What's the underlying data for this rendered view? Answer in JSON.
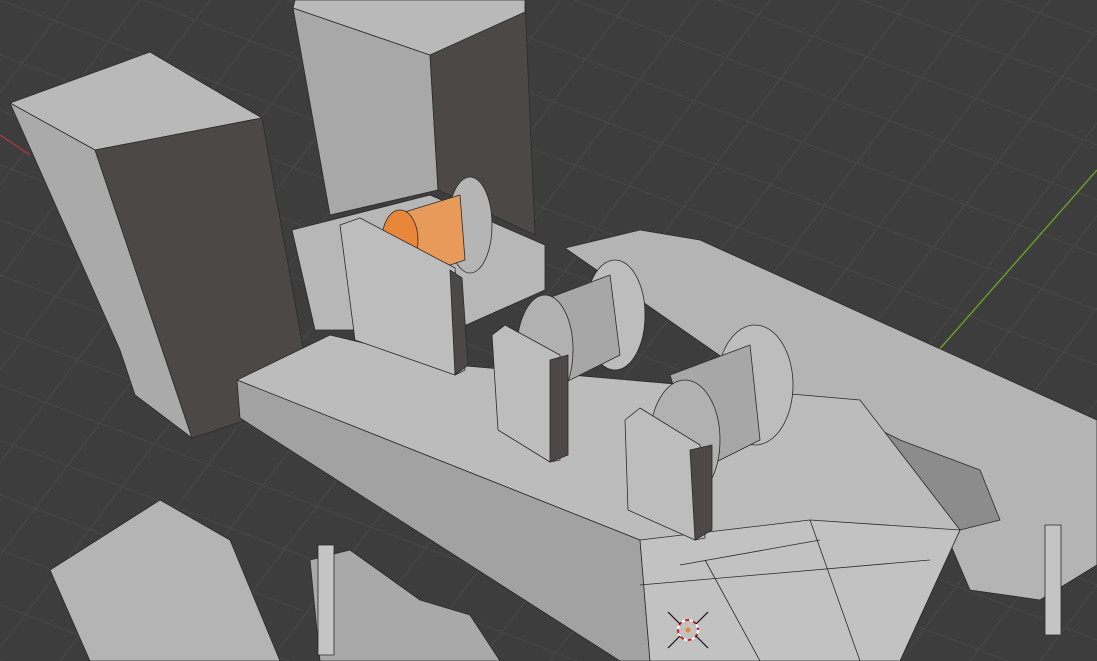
{
  "viewport": {
    "background_color": "#3d3d3d",
    "grid_color": "#494949",
    "x_axis_color": "#a03a3a",
    "y_axis_color": "#6a9a2a",
    "selection_color": "#e8873a",
    "icons": [
      "3d-cursor-icon"
    ]
  }
}
